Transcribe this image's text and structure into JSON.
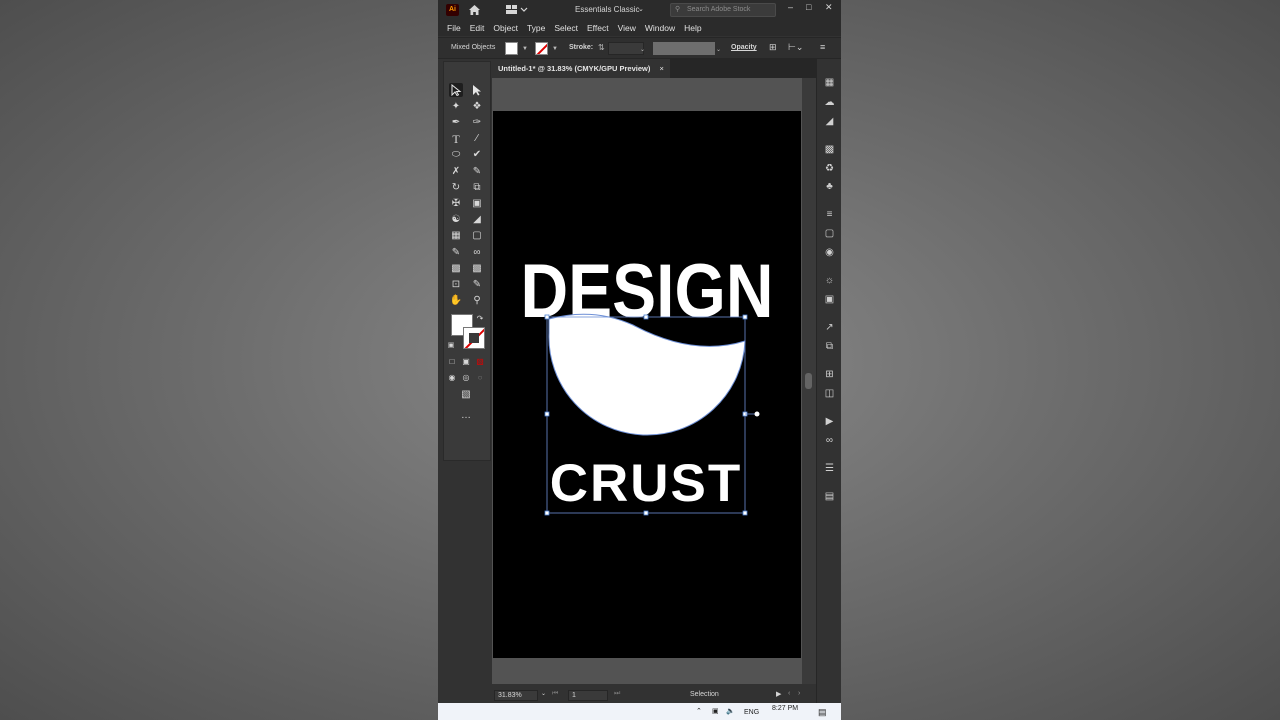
{
  "app": {
    "logo": "Ai",
    "workspace": "Essentials Classic",
    "search_placeholder": "Search Adobe Stock",
    "minimize": "–",
    "maximize": "□",
    "close": "✕"
  },
  "menu": [
    "File",
    "Edit",
    "Object",
    "Type",
    "Select",
    "Effect",
    "View",
    "Window",
    "Help"
  ],
  "control_bar": {
    "selection_label": "Mixed Objects",
    "stroke_label": "Stroke:",
    "opacity_label": "Opacity"
  },
  "document": {
    "tab_title": "Untitled-1* @ 31.83% (CMYK/GPU Preview)",
    "tab_close": "×"
  },
  "artwork": {
    "top_word": "DESIGN",
    "bottom_word": "CRUST",
    "artboard_color": "#000000",
    "shape_color": "#ffffff",
    "selection_color": "#4a7fd1"
  },
  "status_bar": {
    "zoom": "31.83%",
    "page": "1",
    "tool": "Selection"
  },
  "taskbar": {
    "language": "ENG",
    "time": "8:27 PM"
  },
  "tools_more": "…"
}
